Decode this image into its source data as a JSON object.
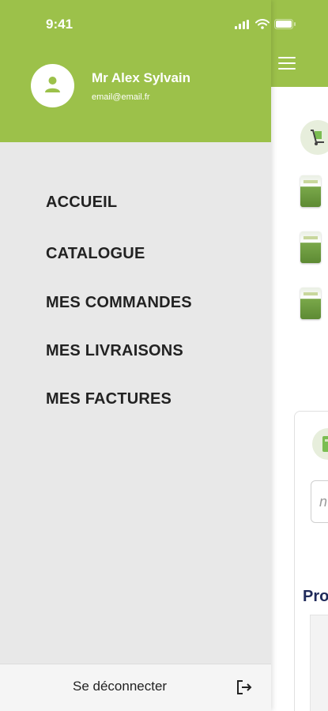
{
  "status_bar": {
    "time": "9:41"
  },
  "drawer": {
    "user": {
      "name": "Mr Alex Sylvain",
      "email": "email@email.fr",
      "avatar_icon": "person-icon"
    },
    "menu_items": [
      {
        "label": "ACCUEIL"
      },
      {
        "label": "CATALOGUE"
      },
      {
        "label": "MES COMMANDES"
      },
      {
        "label": "MES LIVRAISONS"
      },
      {
        "label": "MES FACTURES"
      }
    ],
    "logout": {
      "label": "Se déconnecter",
      "icon": "logout-icon"
    }
  },
  "background_screen": {
    "menu_icon": "hamburger-menu-icon",
    "cart_icon": "hand-truck-icon",
    "input_placeholder": "n",
    "section_label": "Pro"
  },
  "colors": {
    "brand_green": "#9cc14a",
    "drawer_background": "#e8e8e8",
    "menu_text": "#222222",
    "section_title": "#1f2a5a"
  }
}
